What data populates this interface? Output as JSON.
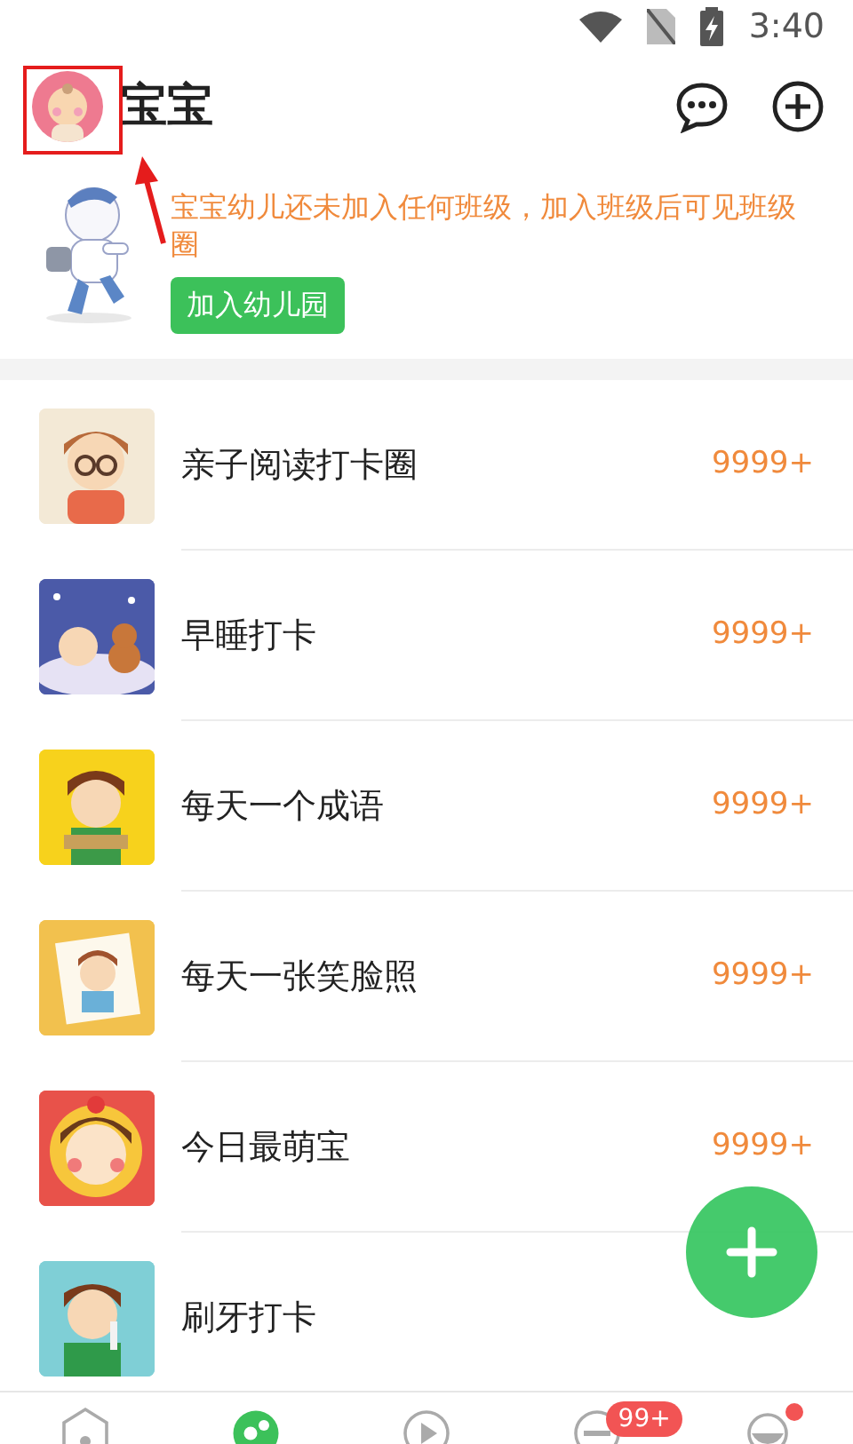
{
  "status_bar": {
    "time": "3:40"
  },
  "header": {
    "title": "宝宝"
  },
  "notice": {
    "message": "宝宝幼儿还未加入任何班级，加入班级后可见班级圈",
    "button": "加入幼儿园"
  },
  "circles": [
    {
      "name": "亲子阅读打卡圈",
      "count": "9999+",
      "color": "#f3e9d6"
    },
    {
      "name": "早睡打卡",
      "count": "9999+",
      "color": "#4b5aa8"
    },
    {
      "name": "每天一个成语",
      "count": "9999+",
      "color": "#f7d21c"
    },
    {
      "name": "每天一张笑脸照",
      "count": "9999+",
      "color": "#f2c14e"
    },
    {
      "name": "今日最萌宝",
      "count": "9999+",
      "color": "#e8524a"
    },
    {
      "name": "刷牙打卡",
      "color": "#7fcfd6"
    }
  ],
  "bottom_nav": [
    {
      "kind": "home",
      "selected": false
    },
    {
      "kind": "circle",
      "selected": true
    },
    {
      "kind": "play",
      "selected": false
    },
    {
      "kind": "message",
      "selected": false,
      "badge": "99+"
    },
    {
      "kind": "profile",
      "selected": false,
      "dot": true
    }
  ]
}
